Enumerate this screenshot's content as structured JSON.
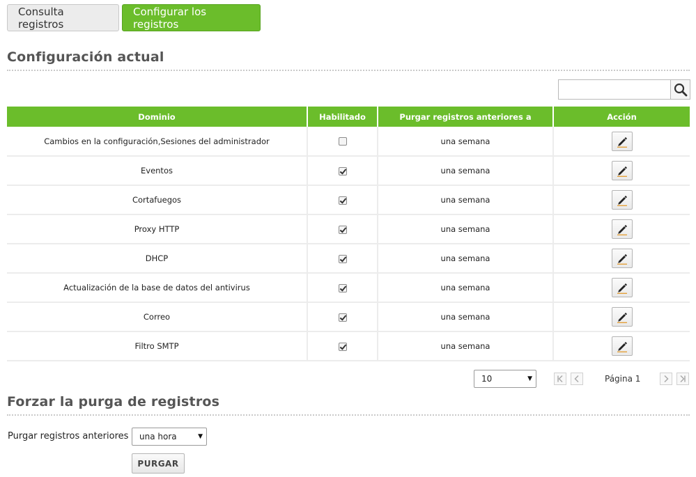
{
  "tabs": [
    {
      "label": "Consulta registros",
      "active": false
    },
    {
      "label": "Configurar los registros",
      "active": true
    }
  ],
  "current_config": {
    "title": "Configuración actual",
    "search_placeholder": "",
    "columns": [
      "Dominio",
      "Habilitado",
      "Purgar registros anteriores a",
      "Acción"
    ],
    "rows": [
      {
        "domain": "Cambios en la configuración,Sesiones del administrador",
        "enabled": false,
        "purge": "una semana"
      },
      {
        "domain": "Eventos",
        "enabled": true,
        "purge": "una semana"
      },
      {
        "domain": "Cortafuegos",
        "enabled": true,
        "purge": "una semana"
      },
      {
        "domain": "Proxy HTTP",
        "enabled": true,
        "purge": "una semana"
      },
      {
        "domain": "DHCP",
        "enabled": true,
        "purge": "una semana"
      },
      {
        "domain": "Actualización de la base de datos del antivirus",
        "enabled": true,
        "purge": "una semana"
      },
      {
        "domain": "Correo",
        "enabled": true,
        "purge": "una semana"
      },
      {
        "domain": "Filtro SMTP",
        "enabled": true,
        "purge": "una semana"
      }
    ]
  },
  "pagination": {
    "page_size": "10",
    "page_label": "Página 1"
  },
  "force_purge": {
    "title": "Forzar la purga de registros",
    "label": "Purgar registros anteriores a:",
    "selected": "una hora",
    "button": "PURGAR"
  },
  "colors": {
    "accent": "#6bbd2b",
    "title": "#555555"
  }
}
